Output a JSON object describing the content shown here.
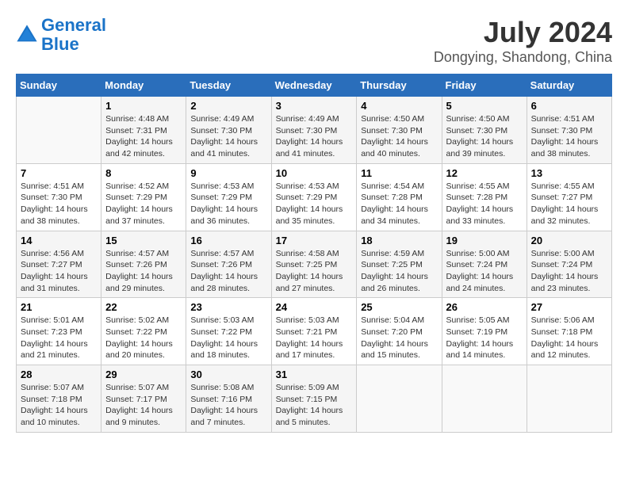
{
  "header": {
    "logo_line1": "General",
    "logo_line2": "Blue",
    "month_year": "July 2024",
    "location": "Dongying, Shandong, China"
  },
  "columns": [
    "Sunday",
    "Monday",
    "Tuesday",
    "Wednesday",
    "Thursday",
    "Friday",
    "Saturday"
  ],
  "weeks": [
    [
      {
        "day": "",
        "info": ""
      },
      {
        "day": "1",
        "info": "Sunrise: 4:48 AM\nSunset: 7:31 PM\nDaylight: 14 hours\nand 42 minutes."
      },
      {
        "day": "2",
        "info": "Sunrise: 4:49 AM\nSunset: 7:30 PM\nDaylight: 14 hours\nand 41 minutes."
      },
      {
        "day": "3",
        "info": "Sunrise: 4:49 AM\nSunset: 7:30 PM\nDaylight: 14 hours\nand 41 minutes."
      },
      {
        "day": "4",
        "info": "Sunrise: 4:50 AM\nSunset: 7:30 PM\nDaylight: 14 hours\nand 40 minutes."
      },
      {
        "day": "5",
        "info": "Sunrise: 4:50 AM\nSunset: 7:30 PM\nDaylight: 14 hours\nand 39 minutes."
      },
      {
        "day": "6",
        "info": "Sunrise: 4:51 AM\nSunset: 7:30 PM\nDaylight: 14 hours\nand 38 minutes."
      }
    ],
    [
      {
        "day": "7",
        "info": "Sunrise: 4:51 AM\nSunset: 7:30 PM\nDaylight: 14 hours\nand 38 minutes."
      },
      {
        "day": "8",
        "info": "Sunrise: 4:52 AM\nSunset: 7:29 PM\nDaylight: 14 hours\nand 37 minutes."
      },
      {
        "day": "9",
        "info": "Sunrise: 4:53 AM\nSunset: 7:29 PM\nDaylight: 14 hours\nand 36 minutes."
      },
      {
        "day": "10",
        "info": "Sunrise: 4:53 AM\nSunset: 7:29 PM\nDaylight: 14 hours\nand 35 minutes."
      },
      {
        "day": "11",
        "info": "Sunrise: 4:54 AM\nSunset: 7:28 PM\nDaylight: 14 hours\nand 34 minutes."
      },
      {
        "day": "12",
        "info": "Sunrise: 4:55 AM\nSunset: 7:28 PM\nDaylight: 14 hours\nand 33 minutes."
      },
      {
        "day": "13",
        "info": "Sunrise: 4:55 AM\nSunset: 7:27 PM\nDaylight: 14 hours\nand 32 minutes."
      }
    ],
    [
      {
        "day": "14",
        "info": "Sunrise: 4:56 AM\nSunset: 7:27 PM\nDaylight: 14 hours\nand 31 minutes."
      },
      {
        "day": "15",
        "info": "Sunrise: 4:57 AM\nSunset: 7:26 PM\nDaylight: 14 hours\nand 29 minutes."
      },
      {
        "day": "16",
        "info": "Sunrise: 4:57 AM\nSunset: 7:26 PM\nDaylight: 14 hours\nand 28 minutes."
      },
      {
        "day": "17",
        "info": "Sunrise: 4:58 AM\nSunset: 7:25 PM\nDaylight: 14 hours\nand 27 minutes."
      },
      {
        "day": "18",
        "info": "Sunrise: 4:59 AM\nSunset: 7:25 PM\nDaylight: 14 hours\nand 26 minutes."
      },
      {
        "day": "19",
        "info": "Sunrise: 5:00 AM\nSunset: 7:24 PM\nDaylight: 14 hours\nand 24 minutes."
      },
      {
        "day": "20",
        "info": "Sunrise: 5:00 AM\nSunset: 7:24 PM\nDaylight: 14 hours\nand 23 minutes."
      }
    ],
    [
      {
        "day": "21",
        "info": "Sunrise: 5:01 AM\nSunset: 7:23 PM\nDaylight: 14 hours\nand 21 minutes."
      },
      {
        "day": "22",
        "info": "Sunrise: 5:02 AM\nSunset: 7:22 PM\nDaylight: 14 hours\nand 20 minutes."
      },
      {
        "day": "23",
        "info": "Sunrise: 5:03 AM\nSunset: 7:22 PM\nDaylight: 14 hours\nand 18 minutes."
      },
      {
        "day": "24",
        "info": "Sunrise: 5:03 AM\nSunset: 7:21 PM\nDaylight: 14 hours\nand 17 minutes."
      },
      {
        "day": "25",
        "info": "Sunrise: 5:04 AM\nSunset: 7:20 PM\nDaylight: 14 hours\nand 15 minutes."
      },
      {
        "day": "26",
        "info": "Sunrise: 5:05 AM\nSunset: 7:19 PM\nDaylight: 14 hours\nand 14 minutes."
      },
      {
        "day": "27",
        "info": "Sunrise: 5:06 AM\nSunset: 7:18 PM\nDaylight: 14 hours\nand 12 minutes."
      }
    ],
    [
      {
        "day": "28",
        "info": "Sunrise: 5:07 AM\nSunset: 7:18 PM\nDaylight: 14 hours\nand 10 minutes."
      },
      {
        "day": "29",
        "info": "Sunrise: 5:07 AM\nSunset: 7:17 PM\nDaylight: 14 hours\nand 9 minutes."
      },
      {
        "day": "30",
        "info": "Sunrise: 5:08 AM\nSunset: 7:16 PM\nDaylight: 14 hours\nand 7 minutes."
      },
      {
        "day": "31",
        "info": "Sunrise: 5:09 AM\nSunset: 7:15 PM\nDaylight: 14 hours\nand 5 minutes."
      },
      {
        "day": "",
        "info": ""
      },
      {
        "day": "",
        "info": ""
      },
      {
        "day": "",
        "info": ""
      }
    ]
  ]
}
